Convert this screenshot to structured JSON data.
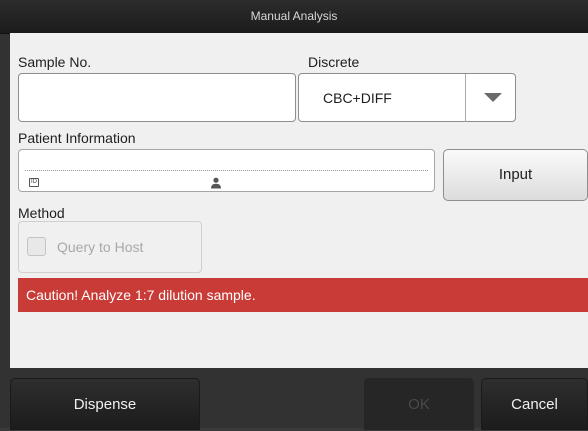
{
  "window": {
    "title": "Manual Analysis"
  },
  "form": {
    "sample_no_label": "Sample No.",
    "sample_no_value": "",
    "discrete_label": "Discrete",
    "discrete_value": "CBC+DIFF",
    "patient_info_label": "Patient Information",
    "patient_id_icon_text": "ID",
    "patient_id_value": "",
    "patient_name_value": "",
    "input_button_label": "Input",
    "method_label": "Method",
    "query_to_host_label": "Query to Host",
    "query_to_host_checked": false,
    "query_to_host_enabled": false
  },
  "caution": {
    "message": "Caution! Analyze 1:7 dilution sample.",
    "color": "#c83b36"
  },
  "footer": {
    "dispense_label": "Dispense",
    "ok_label": "OK",
    "ok_enabled": false,
    "cancel_label": "Cancel"
  },
  "icons": {
    "dropdown": "chevron-down-icon",
    "patient_id": "id-card-icon",
    "patient_name": "person-icon"
  }
}
